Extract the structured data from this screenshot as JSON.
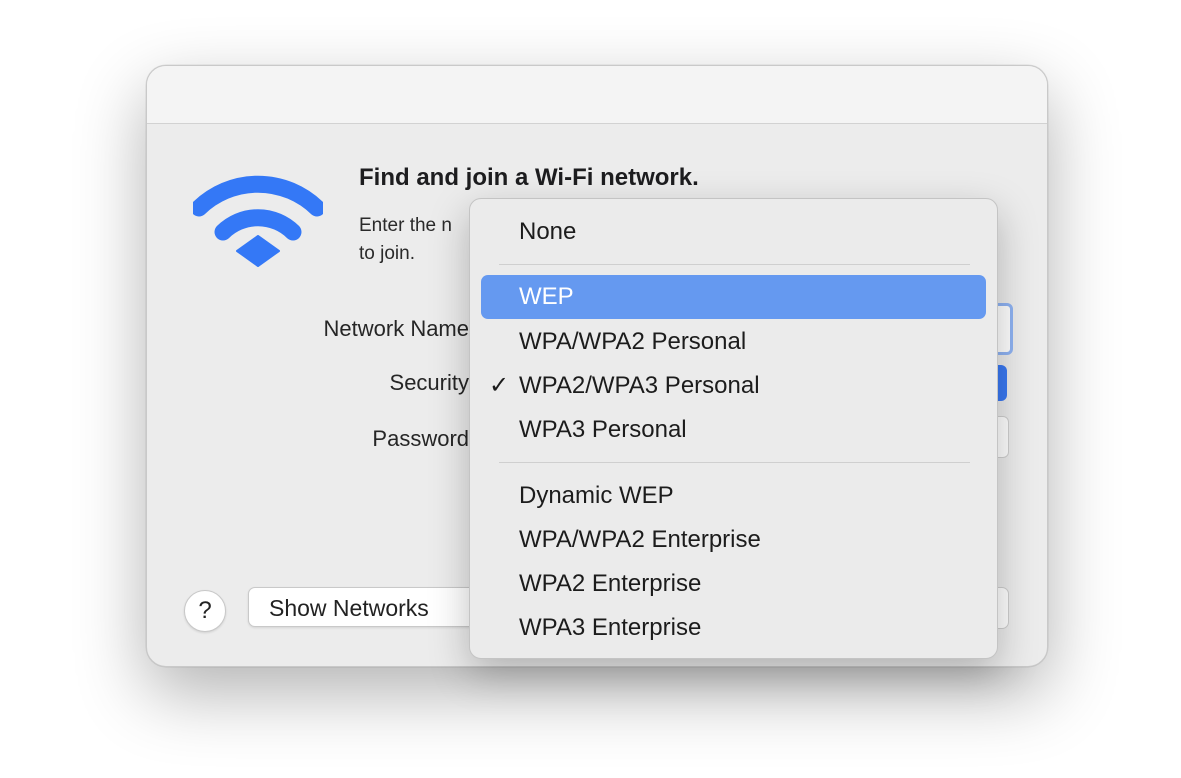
{
  "dialog": {
    "heading": "Find and join a Wi-Fi network.",
    "subtext_line1": "Enter the n",
    "subtext_line2": "to join.",
    "labels": {
      "network_name": "Network Name",
      "security": "Security",
      "password": "Password"
    },
    "help_label": "?",
    "show_networks_label": "Show Networks"
  },
  "security_menu": {
    "groups": [
      [
        "None"
      ],
      [
        "WEP",
        "WPA/WPA2 Personal",
        "WPA2/WPA3 Personal",
        "WPA3 Personal"
      ],
      [
        "Dynamic WEP",
        "WPA/WPA2 Enterprise",
        "WPA2 Enterprise",
        "WPA3 Enterprise"
      ]
    ],
    "highlighted": "WEP",
    "checked": "WPA2/WPA3 Personal",
    "check_glyph": "✓"
  },
  "colors": {
    "accent": "#4a86f5",
    "menu_highlight": "#6599f0",
    "wifi_icon": "#3478f6"
  },
  "icons": {
    "wifi": "wifi-icon",
    "checkmark": "checkmark-icon",
    "help": "question-mark-icon"
  }
}
